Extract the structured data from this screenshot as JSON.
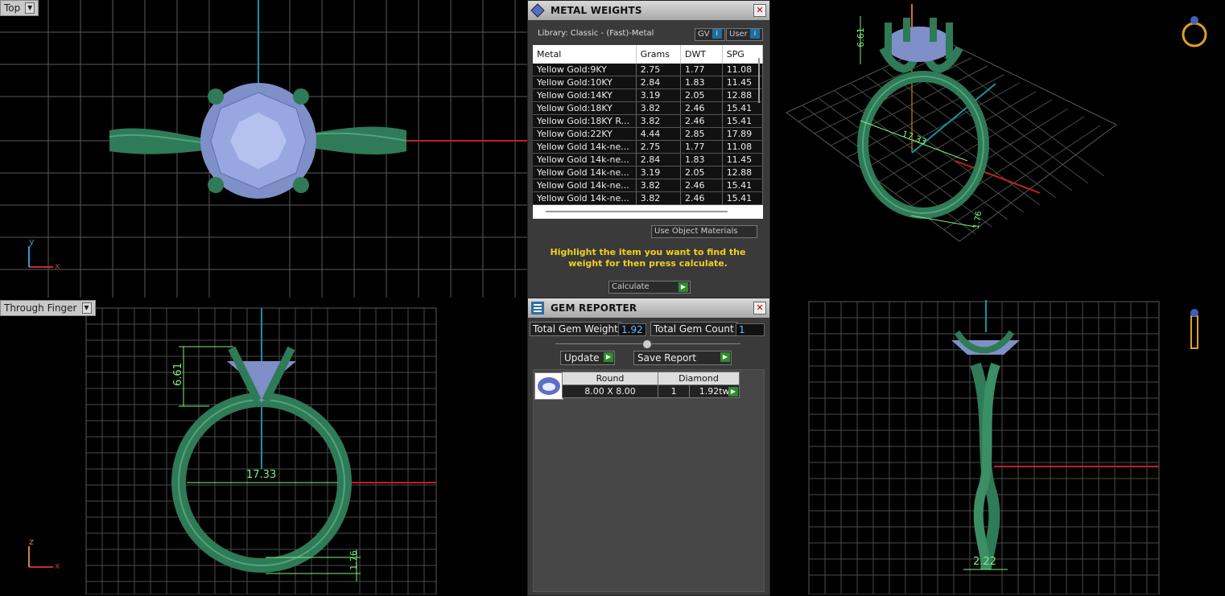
{
  "viewports": {
    "top": {
      "label": "Top"
    },
    "perspective": {
      "label": ""
    },
    "through_finger": {
      "label": "Through Finger"
    },
    "side": {
      "label": ""
    }
  },
  "dimensions": {
    "head_height": "6.61",
    "inner_diameter": "17.33",
    "band_thickness": "1.76",
    "band_width": "2.22"
  },
  "axis_labels": {
    "x": "x",
    "y": "y",
    "z": "z"
  },
  "metal_weights": {
    "title": "METAL WEIGHTS",
    "library": "Library: Classic - (Fast)-Metal",
    "gv_label": "GV",
    "user_label": "User",
    "columns": [
      "Metal",
      "Grams",
      "DWT",
      "SPG"
    ],
    "rows": [
      [
        "Yellow Gold:9KY",
        "2.75",
        "1.77",
        "11.08"
      ],
      [
        "Yellow Gold:10KY",
        "2.84",
        "1.83",
        "11.45"
      ],
      [
        "Yellow Gold:14KY",
        "3.19",
        "2.05",
        "12.88"
      ],
      [
        "Yellow Gold:18KY",
        "3.82",
        "2.46",
        "15.41"
      ],
      [
        "Yellow Gold:18KY R...",
        "3.82",
        "2.46",
        "15.41"
      ],
      [
        "Yellow Gold:22KY",
        "4.44",
        "2.85",
        "17.89"
      ],
      [
        "Yellow Gold 14k-ne...",
        "2.75",
        "1.77",
        "11.08"
      ],
      [
        "Yellow Gold 14k-ne...",
        "2.84",
        "1.83",
        "11.45"
      ],
      [
        "Yellow Gold 14k-ne...",
        "3.19",
        "2.05",
        "12.88"
      ],
      [
        "Yellow Gold 14k-ne...",
        "3.82",
        "2.46",
        "15.41"
      ],
      [
        "Yellow Gold 14k-ne...",
        "3.82",
        "2.46",
        "15.41"
      ]
    ],
    "use_object_materials": "Use Object Materials",
    "hint": "Highlight the item you want to find the weight for then press calculate.",
    "calculate": "Calculate"
  },
  "gem_reporter": {
    "title": "GEM REPORTER",
    "total_weight_label": "Total Gem Weight",
    "total_weight_value": "1.92",
    "total_count_label": "Total Gem Count",
    "total_count_value": "1",
    "update": "Update",
    "save_report": "Save Report",
    "gem": {
      "shape": "Round",
      "size": "8.00 X 8.00",
      "type": "Diamond",
      "count": "1",
      "weight": "1.92tw"
    }
  },
  "colors": {
    "metal": "#2f7a57",
    "stone": "#7f8fc8",
    "accent": "#f0d020",
    "dim": "#7ef07e"
  }
}
